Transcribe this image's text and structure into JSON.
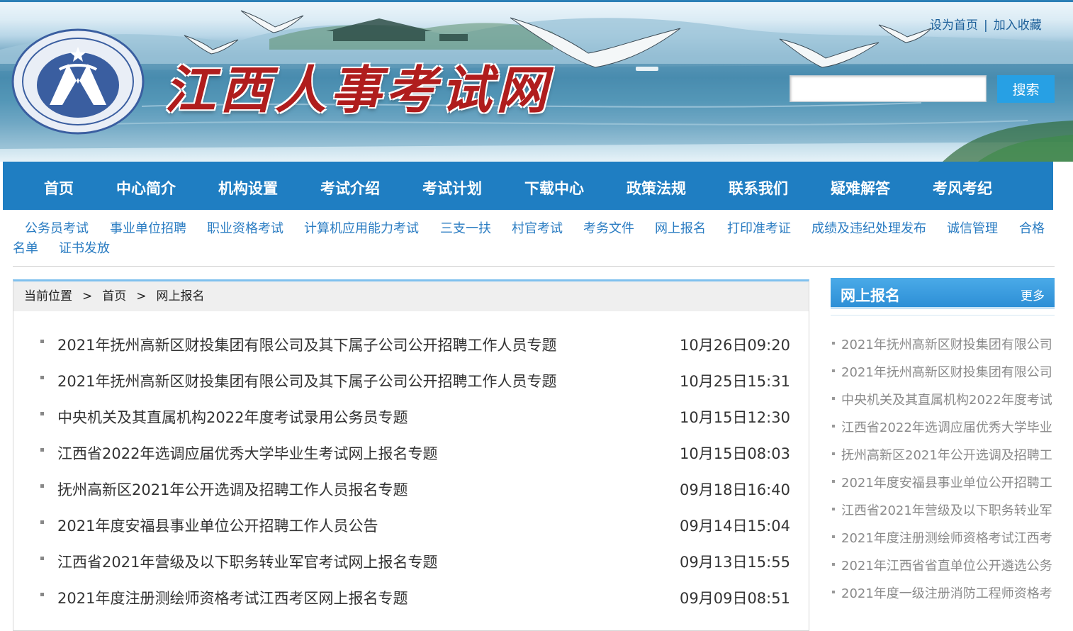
{
  "header": {
    "site_title": "江西人事考试网",
    "links": [
      "设为首页",
      "加入收藏"
    ],
    "link_separator": "|",
    "search_button": "搜索",
    "search_placeholder": ""
  },
  "main_nav": [
    "首页",
    "中心简介",
    "机构设置",
    "考试介绍",
    "考试计划",
    "下载中心",
    "政策法规",
    "联系我们",
    "疑难解答",
    "考风考纪"
  ],
  "sub_nav": [
    "公务员考试",
    "事业单位招聘",
    "职业资格考试",
    "计算机应用能力考试",
    "三支一扶",
    "村官考试",
    "考务文件",
    "网上报名",
    "打印准考证",
    "成绩及违纪处理发布",
    "诚信管理",
    "合格",
    "名单",
    "证书发放"
  ],
  "breadcrumb": {
    "label": "当前位置",
    "separator": ">",
    "items": [
      "首页",
      "网上报名"
    ]
  },
  "news_list": [
    {
      "title": "2021年抚州高新区财投集团有限公司及其下属子公司公开招聘工作人员专题",
      "date": "10月26日09:20"
    },
    {
      "title": "2021年抚州高新区财投集团有限公司及其下属子公司公开招聘工作人员专题",
      "date": "10月25日15:31"
    },
    {
      "title": "中央机关及其直属机构2022年度考试录用公务员专题",
      "date": "10月15日12:30"
    },
    {
      "title": "江西省2022年选调应届优秀大学毕业生考试网上报名专题",
      "date": "10月15日08:03"
    },
    {
      "title": "抚州高新区2021年公开选调及招聘工作人员报名专题",
      "date": "09月18日16:40"
    },
    {
      "title": "2021年度安福县事业单位公开招聘工作人员公告",
      "date": "09月14日15:04"
    },
    {
      "title": "江西省2021年营级及以下职务转业军官考试网上报名专题",
      "date": "09月13日15:55"
    },
    {
      "title": "2021年度注册测绘师资格考试江西考区网上报名专题",
      "date": "09月09日08:51"
    }
  ],
  "side_panel": {
    "title": "网上报名",
    "more": "更多",
    "items": [
      "2021年抚州高新区财投集团有限公司",
      "2021年抚州高新区财投集团有限公司",
      "中央机关及其直属机构2022年度考试",
      "江西省2022年选调应届优秀大学毕业",
      "抚州高新区2021年公开选调及招聘工",
      "2021年度安福县事业单位公开招聘工",
      "江西省2021年营级及以下职务转业军",
      "2021年度注册测绘师资格考试江西考",
      "2021年江西省省直单位公开遴选公务",
      "2021年度一级注册消防工程师资格考"
    ]
  },
  "colors": {
    "nav_bg": "#1f7ec2",
    "link_blue": "#2a7cc2",
    "title_red": "#b01d1d",
    "search_button": "#27a0e4"
  }
}
